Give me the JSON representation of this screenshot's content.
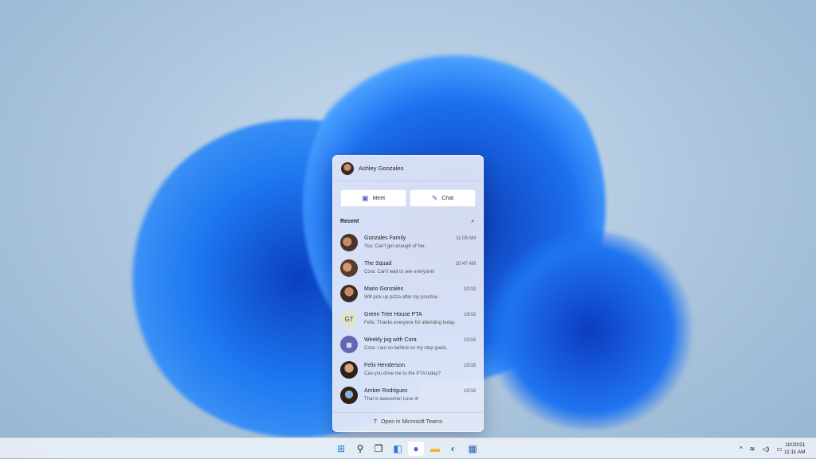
{
  "chat": {
    "user": "Ashley Gonzales",
    "meet_label": "Meet",
    "chat_label": "Chat",
    "recent_label": "Recent",
    "conversations": [
      {
        "name": "Gonzales Family",
        "preview": "You: Can't get enough of her.",
        "time": "11:09 AM"
      },
      {
        "name": "The Squad",
        "preview": "Cora: Can't wait to see everyone!",
        "time": "10:47 AM"
      },
      {
        "name": "Mario Gonzales",
        "preview": "Will pick up pizza after my practice.",
        "time": "10/19"
      },
      {
        "name": "Green Tree House PTA",
        "preview": "Felix: Thanks everyone for attending today.",
        "time": "10/19",
        "initials": "GT"
      },
      {
        "name": "Weekly jog with Cora",
        "preview": "Cora: I am so behind on my step goals.",
        "time": "10/18"
      },
      {
        "name": "Felix Henderson",
        "preview": "Can you drive me to the PTA today?",
        "time": "10/18"
      },
      {
        "name": "Amber Rodriguez",
        "preview": "That is awesome! Love it!",
        "time": "10/18"
      }
    ],
    "open_teams": "Open in Microsoft Teams"
  },
  "taskbar": {
    "date": "10/20/21",
    "time": "11:11 AM",
    "icons": [
      "start",
      "search",
      "task-view",
      "widgets",
      "chat",
      "file-explorer",
      "edge",
      "store"
    ]
  },
  "colors": {
    "accent": "#5b5fc7",
    "bloom": "#1a6cf0"
  }
}
